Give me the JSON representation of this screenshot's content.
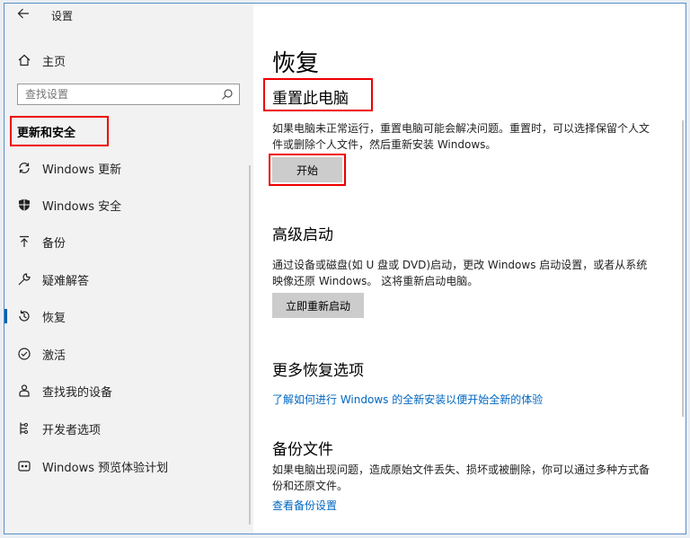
{
  "titlebar": {
    "title": "设置"
  },
  "sidebar": {
    "home_label": "主页",
    "search_placeholder": "查找设置",
    "section_title": "更新和安全",
    "items": [
      {
        "label": "Windows 更新",
        "icon": "sync-icon"
      },
      {
        "label": "Windows 安全",
        "icon": "shield-icon"
      },
      {
        "label": "备份",
        "icon": "backup-arrow-icon"
      },
      {
        "label": "疑难解答",
        "icon": "wrench-icon"
      },
      {
        "label": "恢复",
        "icon": "history-icon",
        "active": true
      },
      {
        "label": "激活",
        "icon": "check-circle-icon"
      },
      {
        "label": "查找我的设备",
        "icon": "person-location-icon"
      },
      {
        "label": "开发者选项",
        "icon": "dev-tools-icon"
      },
      {
        "label": "Windows 预览体验计划",
        "icon": "insider-icon"
      }
    ]
  },
  "main": {
    "page_title": "恢复",
    "reset": {
      "heading": "重置此电脑",
      "description": "如果电脑未正常运行，重置电脑可能会解决问题。重置时，可以选择保留个人文件或删除个人文件，然后重新安装 Windows。",
      "button_label": "开始"
    },
    "advanced": {
      "heading": "高级启动",
      "description": "通过设备或磁盘(如 U 盘或 DVD)启动，更改 Windows 启动设置，或者从系统映像还原 Windows。 这将重新启动电脑。",
      "button_label": "立即重新启动"
    },
    "more": {
      "heading": "更多恢复选项",
      "link": "了解如何进行 Windows 的全新安装以便开始全新的体验"
    },
    "backup": {
      "heading": "备份文件",
      "description": "如果电脑出现问题，造成原始文件丢失、损坏或被删除，你可以通过多种方式备份和还原文件。",
      "link": "查看备份设置"
    }
  },
  "colors": {
    "accent": "#0063b1",
    "link": "#0067c0",
    "highlight": "#e00000",
    "sidebar_bg": "#f2f2f2",
    "button_bg": "#cccccc"
  }
}
